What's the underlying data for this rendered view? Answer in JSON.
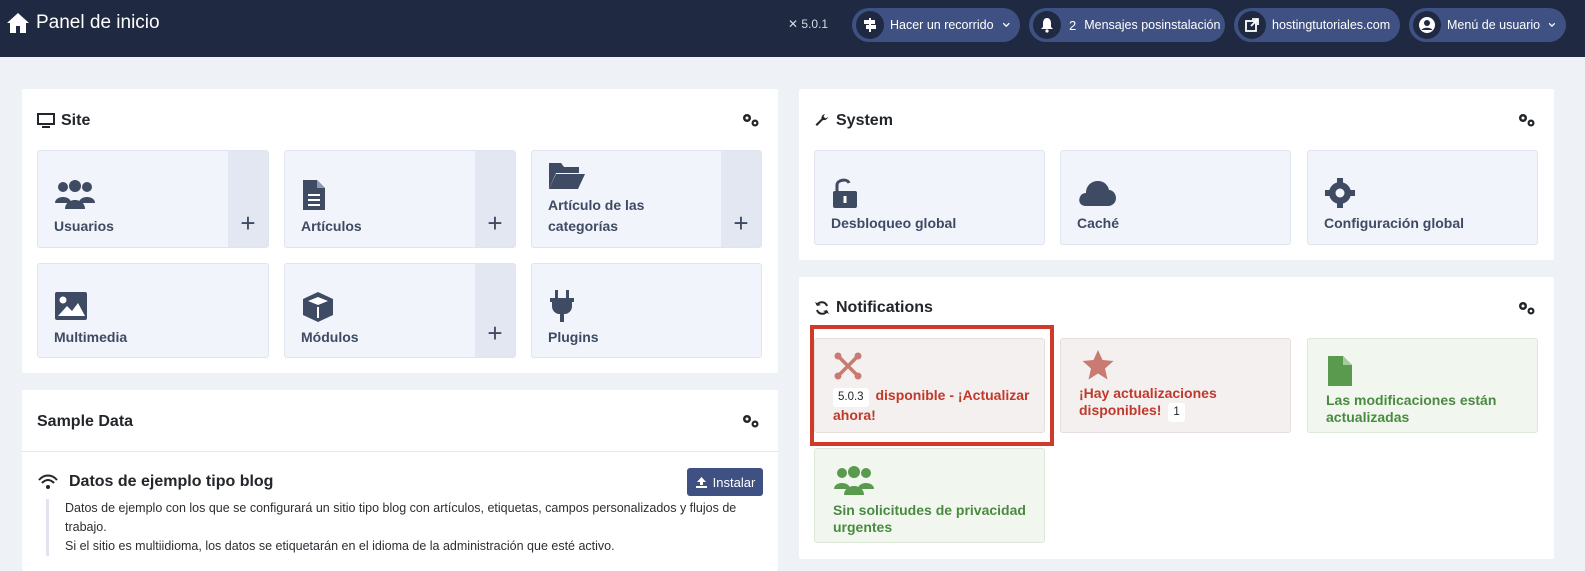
{
  "header": {
    "title": "Panel de inicio",
    "version": "5.0.1",
    "tour_label": "Hacer un recorrido",
    "messages_count": "2",
    "messages_label": "Mensajes posinstalación",
    "site_label": "hostingtutoriales.com",
    "user_menu_label": "Menú de usuario"
  },
  "site": {
    "title": "Site",
    "tiles": [
      {
        "label": "Usuarios",
        "has_add": true
      },
      {
        "label": "Artículos",
        "has_add": true
      },
      {
        "label": "Artículo de las categorías",
        "has_add": true
      },
      {
        "label": "Multimedia",
        "has_add": false
      },
      {
        "label": "Módulos",
        "has_add": true
      },
      {
        "label": "Plugins",
        "has_add": false
      }
    ],
    "add_symbol": "+"
  },
  "system": {
    "title": "System",
    "tiles": [
      {
        "label": "Desbloqueo global"
      },
      {
        "label": "Caché"
      },
      {
        "label": "Configuración global"
      }
    ]
  },
  "notifications": {
    "title": "Notifications",
    "tiles": [
      {
        "badge": "5.0.3",
        "label": "disponible - ¡Actualizar ahora!"
      },
      {
        "label": "¡Hay actualizaciones disponibles!",
        "badge": "1"
      },
      {
        "label": "Las modificaciones están actualizadas"
      },
      {
        "label": "Sin solicitudes de privacidad urgentes"
      }
    ]
  },
  "sample_data": {
    "title": "Sample Data",
    "item_title": "Datos de ejemplo tipo blog",
    "install_label": "Instalar",
    "description_1": "Datos de ejemplo con los que se configurará un sitio tipo blog con artículos, etiquetas, campos personalizados y flujos de trabajo.",
    "description_2": "Si el sitio es multiidioma, los datos se etiquetarán en el idioma de la administración que esté activo."
  },
  "colors": {
    "header_bg": "#1f2942",
    "pill_bg": "#3f5182",
    "tile_text": "#3f4a63",
    "danger_text": "#c0392b",
    "danger_bg": "#f3f0ef",
    "success_text": "#4a8a40",
    "success_bg": "#f1f7ef",
    "highlight": "#d03a2b"
  }
}
